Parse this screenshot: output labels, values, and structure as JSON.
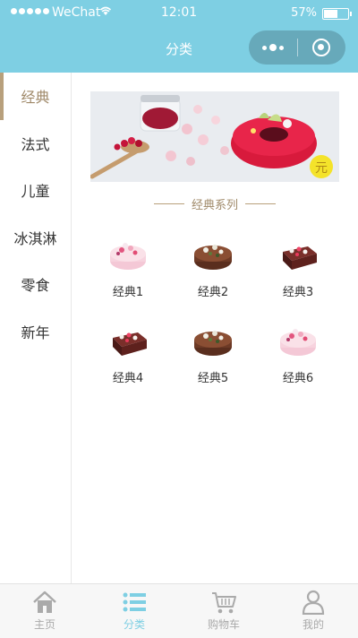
{
  "status_bar": {
    "carrier": "WeChat",
    "time": "12:01",
    "battery": "57%"
  },
  "nav": {
    "title": "分类"
  },
  "sidebar": {
    "items": [
      {
        "label": "经典",
        "active": true
      },
      {
        "label": "法式",
        "active": false
      },
      {
        "label": "儿童",
        "active": false
      },
      {
        "label": "冰淇淋",
        "active": false
      },
      {
        "label": "零食",
        "active": false
      },
      {
        "label": "新年",
        "active": false
      }
    ]
  },
  "main": {
    "section_title": "经典系列",
    "products": [
      {
        "name": "经典1",
        "icon": "pink-cake-icon"
      },
      {
        "name": "经典2",
        "icon": "chocolate-cake-icon"
      },
      {
        "name": "经典3",
        "icon": "brownie-cake-icon"
      },
      {
        "name": "经典4",
        "icon": "brownie-cake-icon"
      },
      {
        "name": "经典5",
        "icon": "chocolate-cake-icon"
      },
      {
        "name": "经典6",
        "icon": "pink-cake-icon"
      }
    ]
  },
  "tabbar": {
    "tabs": [
      {
        "label": "主页",
        "icon": "home-icon",
        "active": false
      },
      {
        "label": "分类",
        "icon": "list-icon",
        "active": true
      },
      {
        "label": "购物车",
        "icon": "cart-icon",
        "active": false
      },
      {
        "label": "我的",
        "icon": "user-icon",
        "active": false
      }
    ]
  },
  "colors": {
    "nav_bg": "#7ecfe3",
    "accent_gold": "#b8a07c",
    "active_tab": "#7ecfe3"
  }
}
